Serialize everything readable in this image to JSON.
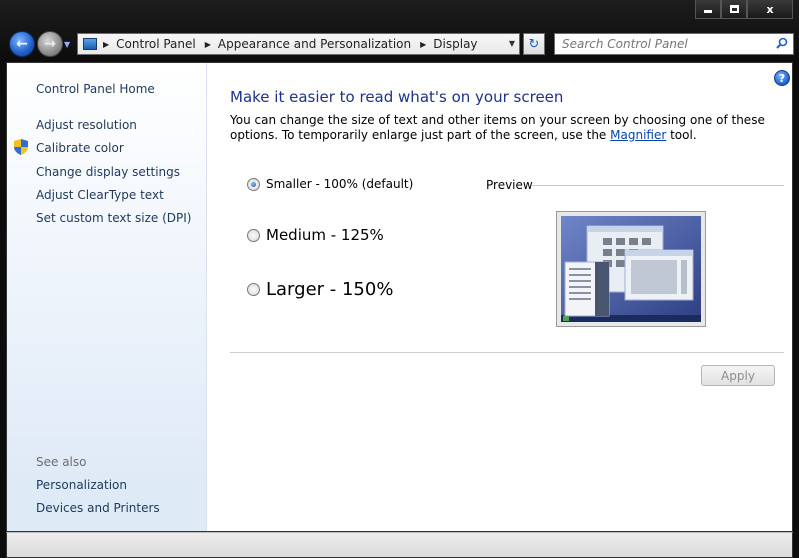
{
  "window": {
    "minimize": "",
    "maximize": "",
    "close": "x"
  },
  "nav": {
    "breadcrumbs": [
      "Control Panel",
      "Appearance and Personalization",
      "Display"
    ],
    "search_placeholder": "Search Control Panel"
  },
  "sidebar": {
    "home": "Control Panel Home",
    "links": [
      "Adjust resolution",
      "Calibrate color",
      "Change display settings",
      "Adjust ClearType text",
      "Set custom text size (DPI)"
    ],
    "see_also_label": "See also",
    "see_also": [
      "Personalization",
      "Devices and Printers"
    ]
  },
  "main": {
    "title": "Make it easier to read what's on your screen",
    "description_pre": "You can change the size of text and other items on your screen by choosing one of these options. To temporarily enlarge just part of the screen, use the ",
    "description_link": "Magnifier",
    "description_post": " tool.",
    "options": [
      {
        "label": "Smaller - 100% (default)",
        "selected": true
      },
      {
        "label": "Medium - 125%",
        "selected": false
      },
      {
        "label": "Larger - 150%",
        "selected": false
      }
    ],
    "preview_label": "Preview",
    "apply_label": "Apply"
  },
  "colors": {
    "title_blue": "#1e3287",
    "link_dark": "#1e395b",
    "link_blue": "#0645ad",
    "accent": "#1f5fc9"
  }
}
